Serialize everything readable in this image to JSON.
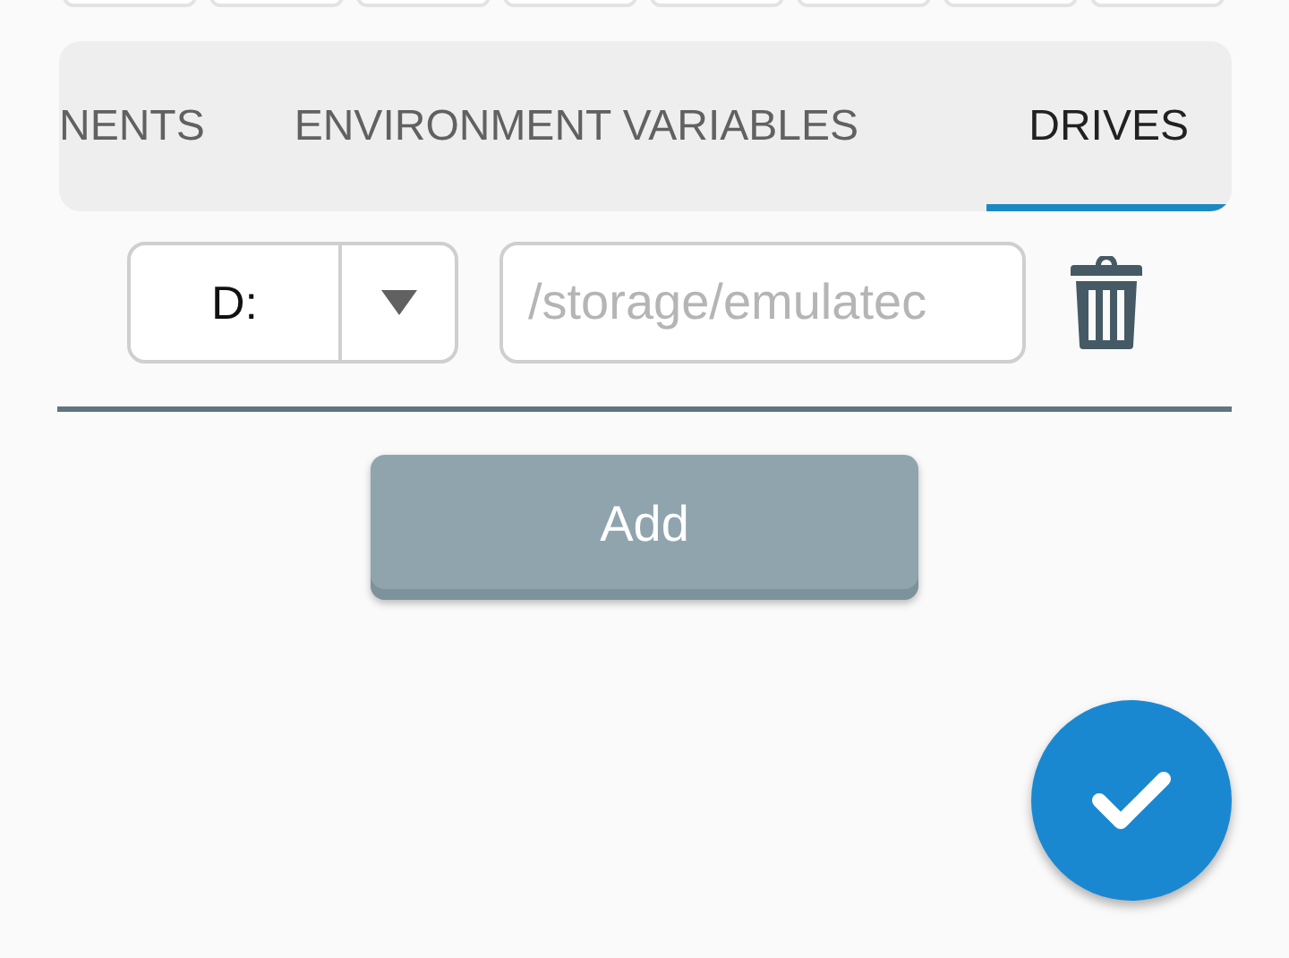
{
  "top_buttons": [
    {
      "kind": "button"
    },
    {
      "kind": "button"
    },
    {
      "kind": "button"
    },
    {
      "kind": "button"
    },
    {
      "kind": "button"
    },
    {
      "kind": "button"
    },
    {
      "kind": "button"
    },
    {
      "kind": "button"
    }
  ],
  "tabs": [
    {
      "label": "NENTS",
      "selected": false
    },
    {
      "label": "ENVIRONMENT VARIABLES",
      "selected": false
    },
    {
      "label": "DRIVES",
      "selected": true
    }
  ],
  "drives": [
    {
      "letter": "D:",
      "path_placeholder": "/storage/emulatec"
    }
  ],
  "add_button": "Add",
  "fab": {
    "kind": "check"
  }
}
